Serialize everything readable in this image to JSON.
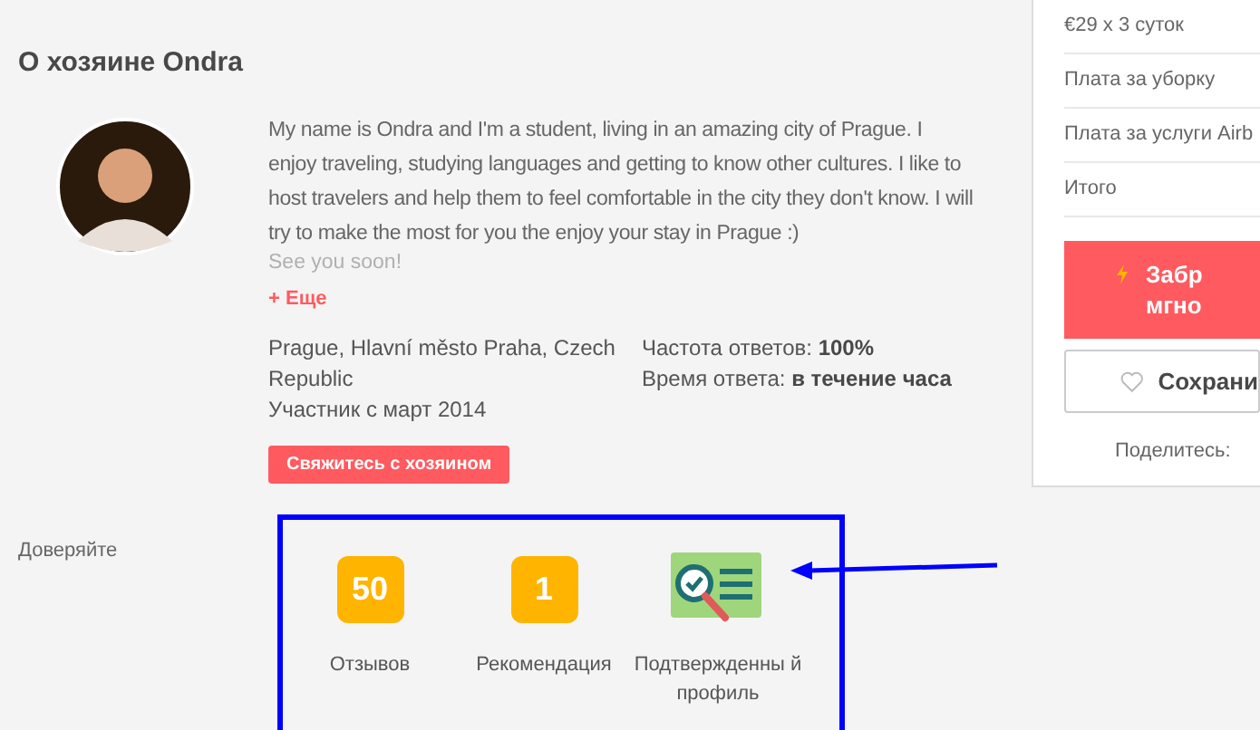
{
  "host": {
    "title": "О хозяине Ondra",
    "about": "My name is Ondra and I'm a student, living in an amazing city of Prague. I enjoy traveling, studying languages and getting to know other cultures. I like to host travelers and help them to feel comfortable in the city they don't know. I will try to make the most for you the enjoy your stay in Prague :)",
    "about_faded": "See you soon!",
    "more": "+ Еще",
    "location": "Prague, Hlavní město Praha, Czech Republic",
    "member_since": "Участник с март 2014",
    "response_rate_label": "Частота ответов:",
    "response_rate": "100%",
    "response_time_label": "Время ответа:",
    "response_time": "в течение часа",
    "contact_button": "Свяжитесь с хозяином"
  },
  "trust": {
    "label": "Доверяйте",
    "badges": [
      {
        "kind": "count",
        "value": "50",
        "label": "Отзывов"
      },
      {
        "kind": "count",
        "value": "1",
        "label": "Рекомендация"
      },
      {
        "kind": "verified",
        "label": "Подтвержденны й профиль"
      }
    ]
  },
  "price": {
    "rows": [
      "€29 x 3 суток",
      "Плата за уборку",
      "Плата за услуги Airb",
      "Итого"
    ],
    "book_button": [
      "Забр",
      "мгно"
    ],
    "save_button": "Сохрани",
    "share_label": "Поделитесь:"
  }
}
